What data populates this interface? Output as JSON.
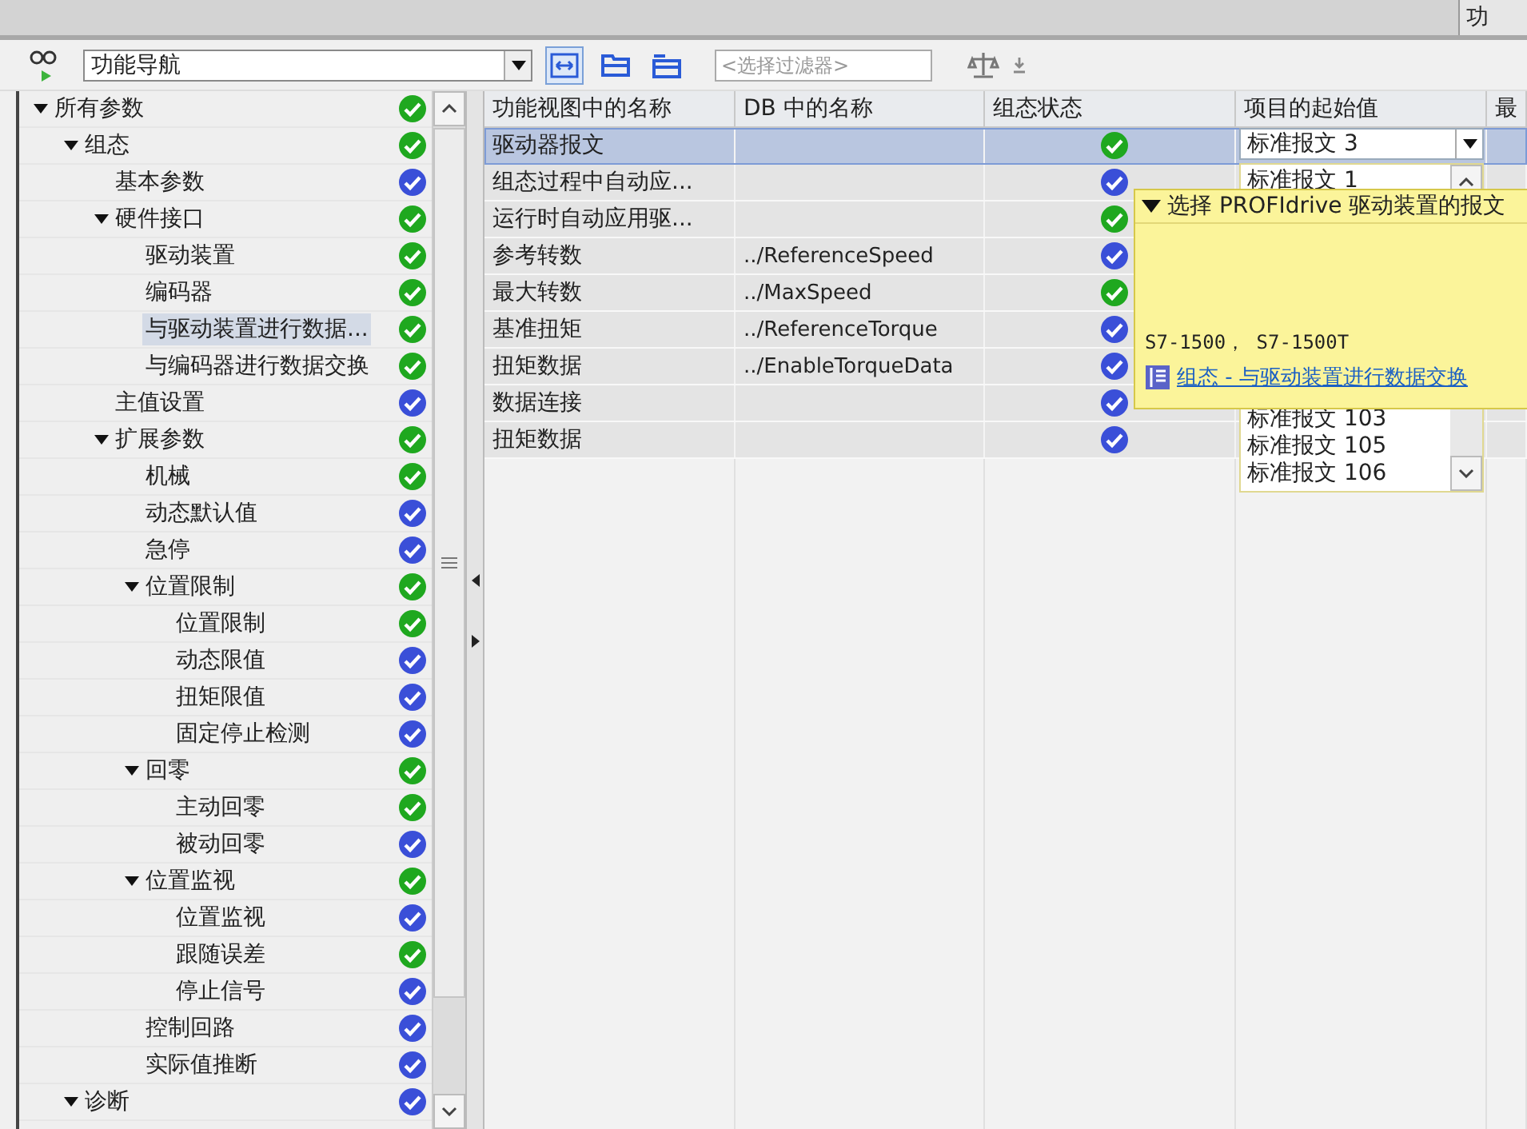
{
  "top_tab": {
    "label": "功"
  },
  "toolbar": {
    "navigation_select": {
      "value": "功能导航"
    },
    "filter": {
      "placeholder": "<选择过滤器>"
    }
  },
  "tree": [
    {
      "label": "所有参数",
      "color": "#1fa81f",
      "expanded": true,
      "selected": false,
      "children": [
        {
          "label": "组态",
          "color": "#1fa81f",
          "expanded": true,
          "selected": false,
          "children": [
            {
              "label": "基本参数",
              "color": "#3a4fd8",
              "selected": false
            },
            {
              "label": "硬件接口",
              "color": "#1fa81f",
              "expanded": true,
              "selected": false,
              "children": [
                {
                  "label": "驱动装置",
                  "color": "#1fa81f",
                  "selected": false
                },
                {
                  "label": "编码器",
                  "color": "#1fa81f",
                  "selected": false
                },
                {
                  "label": "与驱动装置进行数据...",
                  "color": "#1fa81f",
                  "selected": true
                },
                {
                  "label": "与编码器进行数据交换",
                  "color": "#1fa81f",
                  "selected": false
                }
              ]
            },
            {
              "label": "主值设置",
              "color": "#3a4fd8",
              "selected": false
            },
            {
              "label": "扩展参数",
              "color": "#1fa81f",
              "expanded": true,
              "selected": false,
              "children": [
                {
                  "label": "机械",
                  "color": "#1fa81f",
                  "selected": false
                },
                {
                  "label": "动态默认值",
                  "color": "#3a4fd8",
                  "selected": false
                },
                {
                  "label": "急停",
                  "color": "#3a4fd8",
                  "selected": false
                },
                {
                  "label": "位置限制",
                  "color": "#1fa81f",
                  "expanded": true,
                  "selected": false,
                  "children": [
                    {
                      "label": "位置限制",
                      "color": "#1fa81f",
                      "selected": false
                    },
                    {
                      "label": "动态限值",
                      "color": "#3a4fd8",
                      "selected": false
                    },
                    {
                      "label": "扭矩限值",
                      "color": "#3a4fd8",
                      "selected": false
                    },
                    {
                      "label": "固定停止检测",
                      "color": "#3a4fd8",
                      "selected": false
                    }
                  ]
                },
                {
                  "label": "回零",
                  "color": "#1fa81f",
                  "expanded": true,
                  "selected": false,
                  "children": [
                    {
                      "label": "主动回零",
                      "color": "#1fa81f",
                      "selected": false
                    },
                    {
                      "label": "被动回零",
                      "color": "#3a4fd8",
                      "selected": false
                    }
                  ]
                },
                {
                  "label": "位置监视",
                  "color": "#1fa81f",
                  "expanded": true,
                  "selected": false,
                  "children": [
                    {
                      "label": "位置监视",
                      "color": "#3a4fd8",
                      "selected": false
                    },
                    {
                      "label": "跟随误差",
                      "color": "#1fa81f",
                      "selected": false
                    },
                    {
                      "label": "停止信号",
                      "color": "#3a4fd8",
                      "selected": false
                    }
                  ]
                },
                {
                  "label": "控制回路",
                  "color": "#3a4fd8",
                  "selected": false
                },
                {
                  "label": "实际值推断",
                  "color": "#3a4fd8",
                  "selected": false
                }
              ]
            }
          ]
        },
        {
          "label": "诊断",
          "color": "#3a4fd8",
          "expanded": true,
          "selected": false
        }
      ]
    }
  ],
  "table": {
    "columns": [
      "功能视图中的名称",
      "DB 中的名称",
      "组态状态",
      "项目的起始值",
      "最"
    ],
    "rows": [
      {
        "name": "驱动器报文",
        "color": "#1fa81f",
        "selected": true,
        "start_value": "标准报文 3"
      },
      {
        "name": "组态过程中自动应...",
        "color": "#3a4fd8",
        "selected": false
      },
      {
        "name": "运行时自动应用驱...",
        "color": "#1fa81f",
        "selected": false
      },
      {
        "name": "参考转数",
        "db_name": "../ReferenceSpeed",
        "color": "#3a4fd8",
        "selected": false
      },
      {
        "name": "最大转数",
        "db_name": "../MaxSpeed",
        "color": "#1fa81f",
        "selected": false
      },
      {
        "name": "基准扭矩",
        "db_name": "../ReferenceTorque",
        "color": "#3a4fd8",
        "selected": false
      },
      {
        "name": "扭矩数据",
        "db_name": "../EnableTorqueData",
        "color": "#3a4fd8",
        "selected": false
      },
      {
        "name": "数据连接",
        "color": "#3a4fd8",
        "selected": false
      },
      {
        "name": "扭矩数据",
        "color": "#3a4fd8",
        "selected": false
      }
    ]
  },
  "dropdown_list": {
    "items": [
      "标准报文 1",
      "标准报文 103",
      "标准报文 105",
      "标准报文 106"
    ]
  },
  "tooltip": {
    "title": "选择 PROFIdrive 驱动装置的报文",
    "expanded": true,
    "text": "S7-1500， S7-1500T",
    "link": "组态 - 与驱动装置进行数据交换"
  }
}
